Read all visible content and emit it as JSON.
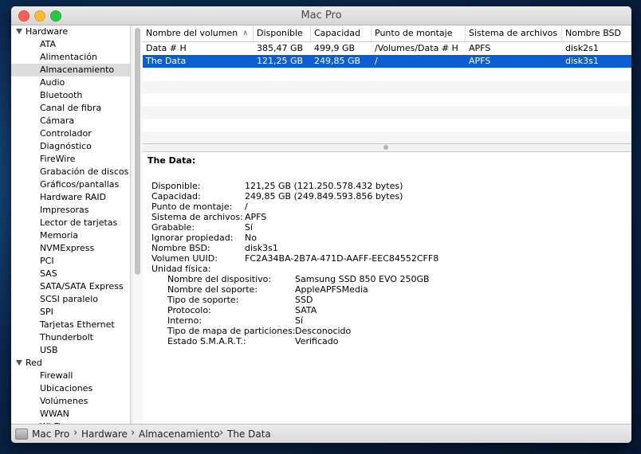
{
  "window": {
    "title": "Mac Pro"
  },
  "sidebar": {
    "groups": [
      {
        "label": "Hardware",
        "items": [
          "ATA",
          "Alimentación",
          "Almacenamiento",
          "Audio",
          "Bluetooth",
          "Canal de fibra",
          "Cámara",
          "Controlador",
          "Diagnóstico",
          "FireWire",
          "Grabación de discos",
          "Gráficos/pantallas",
          "Hardware RAID",
          "Impresoras",
          "Lector de tarjetas",
          "Memoria",
          "NVMExpress",
          "PCI",
          "SAS",
          "SATA/SATA Express",
          "SCSI paralelo",
          "SPI",
          "Tarjetas Ethernet",
          "Thunderbolt",
          "USB"
        ]
      },
      {
        "label": "Red",
        "items": [
          "Firewall",
          "Ubicaciones",
          "Volúmenes",
          "WWAN",
          "Wi-Fi"
        ]
      }
    ],
    "selected": "Almacenamiento"
  },
  "table": {
    "columns": [
      "Nombre del volumen",
      "Disponible",
      "Capacidad",
      "Punto de montaje",
      "Sistema de archivos",
      "Nombre BSD"
    ],
    "rows": [
      [
        "Data # H",
        "385,47 GB",
        "499,9 GB",
        "/Volumes/Data # H",
        "APFS",
        "disk2s1"
      ],
      [
        "The Data",
        "121,25 GB",
        "249,85 GB",
        "/",
        "APFS",
        "disk3s1"
      ]
    ],
    "selected_row": 1
  },
  "detail": {
    "title": "The Data:",
    "fields": [
      {
        "k": "Disponible:",
        "v": "121,25 GB (121.250.578.432 bytes)"
      },
      {
        "k": "Capacidad:",
        "v": "249,85 GB (249.849.593.856 bytes)"
      },
      {
        "k": "Punto de montaje:",
        "v": "/"
      },
      {
        "k": "Sistema de archivos:",
        "v": "APFS"
      },
      {
        "k": "Grabable:",
        "v": "Sí"
      },
      {
        "k": "Ignorar propiedad:",
        "v": "No"
      },
      {
        "k": "Nombre BSD:",
        "v": "disk3s1"
      },
      {
        "k": "Volumen UUID:",
        "v": "FC2A34BA-2B7A-471D-AAFF-EEC84552CFF8"
      }
    ],
    "physical_label": "Unidad física:",
    "physical": [
      {
        "k": "Nombre del dispositivo:",
        "v": "Samsung SSD 850 EVO 250GB"
      },
      {
        "k": "Nombre del soporte:",
        "v": "AppleAPFSMedia"
      },
      {
        "k": "Tipo de soporte:",
        "v": "SSD"
      },
      {
        "k": "Protocolo:",
        "v": "SATA"
      },
      {
        "k": "Interno:",
        "v": "Sí"
      },
      {
        "k": "Tipo de mapa de particiones:",
        "v": "Desconocido"
      },
      {
        "k": "Estado S.M.A.R.T.:",
        "v": "Verificado"
      }
    ]
  },
  "statusbar": {
    "crumbs": [
      "Mac Pro",
      "Hardware",
      "Almacenamiento",
      "The Data"
    ]
  }
}
